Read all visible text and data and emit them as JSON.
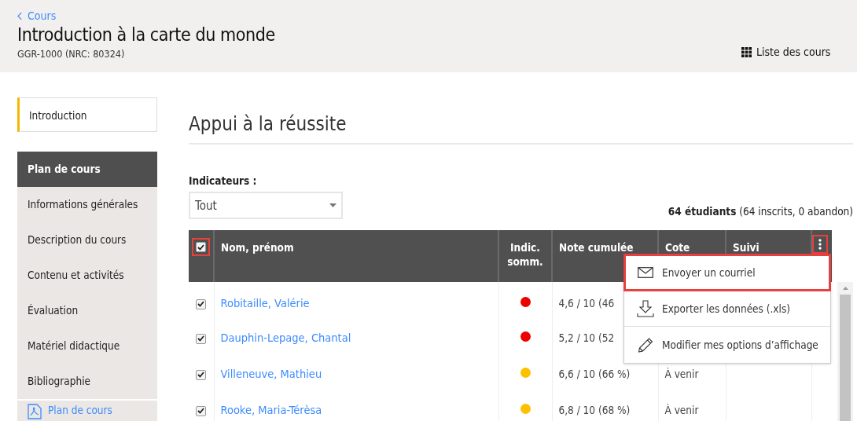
{
  "header": {
    "back_link": "Cours",
    "title": "Introduction à la carte du monde",
    "subtitle": "GGR-1000 (NRC: 80324)",
    "course_list_button": "Liste des cours"
  },
  "sidebar": {
    "intro": {
      "label": "Introduction",
      "selected": true
    },
    "section": {
      "label": "Plan de cours"
    },
    "items": [
      {
        "label": "Informations générales",
        "selected": false
      },
      {
        "label": "Description du cours",
        "selected": false
      },
      {
        "label": "Contenu et activités",
        "selected": false
      },
      {
        "label": "Évaluation",
        "selected": false
      },
      {
        "label": "Matériel didactique",
        "selected": false
      },
      {
        "label": "Bibliographie",
        "selected": false
      }
    ],
    "pdf_link": "Plan de cours"
  },
  "main": {
    "heading": "Appui à la réussite",
    "filter": {
      "label": "Indicateurs :",
      "value": "Tout"
    },
    "count": "64 étudiants",
    "count_detail": "(64 inscrits, 0 abandon)"
  },
  "table": {
    "select_all": {
      "checked": true,
      "highlighted": true
    },
    "menu_button": {
      "highlighted": true
    },
    "columns": [
      "Nom, prénom",
      "Indic. somm.",
      "Note cumulée",
      "Cote",
      "Suivi"
    ],
    "rows": [
      {
        "checked": true,
        "name": "Robitaille, Valérie",
        "color": "#ee0000",
        "note": "4,6 / 10 (46"
      },
      {
        "checked": true,
        "name": "Dauphin-Lepage, Chantal",
        "color": "#ee0000",
        "note": "5,2 / 10 (52"
      },
      {
        "checked": true,
        "name": "Villeneuve, Mathieu",
        "color": "#ffc000",
        "note": "6,6 / 10 (66 %)",
        "cote": "À venir"
      },
      {
        "checked": true,
        "name": "Rooke, Maria-Térèsa",
        "color": "#ffc000",
        "note": "6,8 / 10 (68 %)",
        "cote": "À venir"
      }
    ]
  },
  "menu": [
    {
      "kind": "mail",
      "label": "Envoyer un courriel",
      "highlighted": true
    },
    {
      "kind": "download",
      "label": "Exporter les données (.xls)",
      "highlighted": false
    },
    {
      "kind": "edit",
      "label": "Modifier mes options d’affichage",
      "highlighted": false
    }
  ]
}
